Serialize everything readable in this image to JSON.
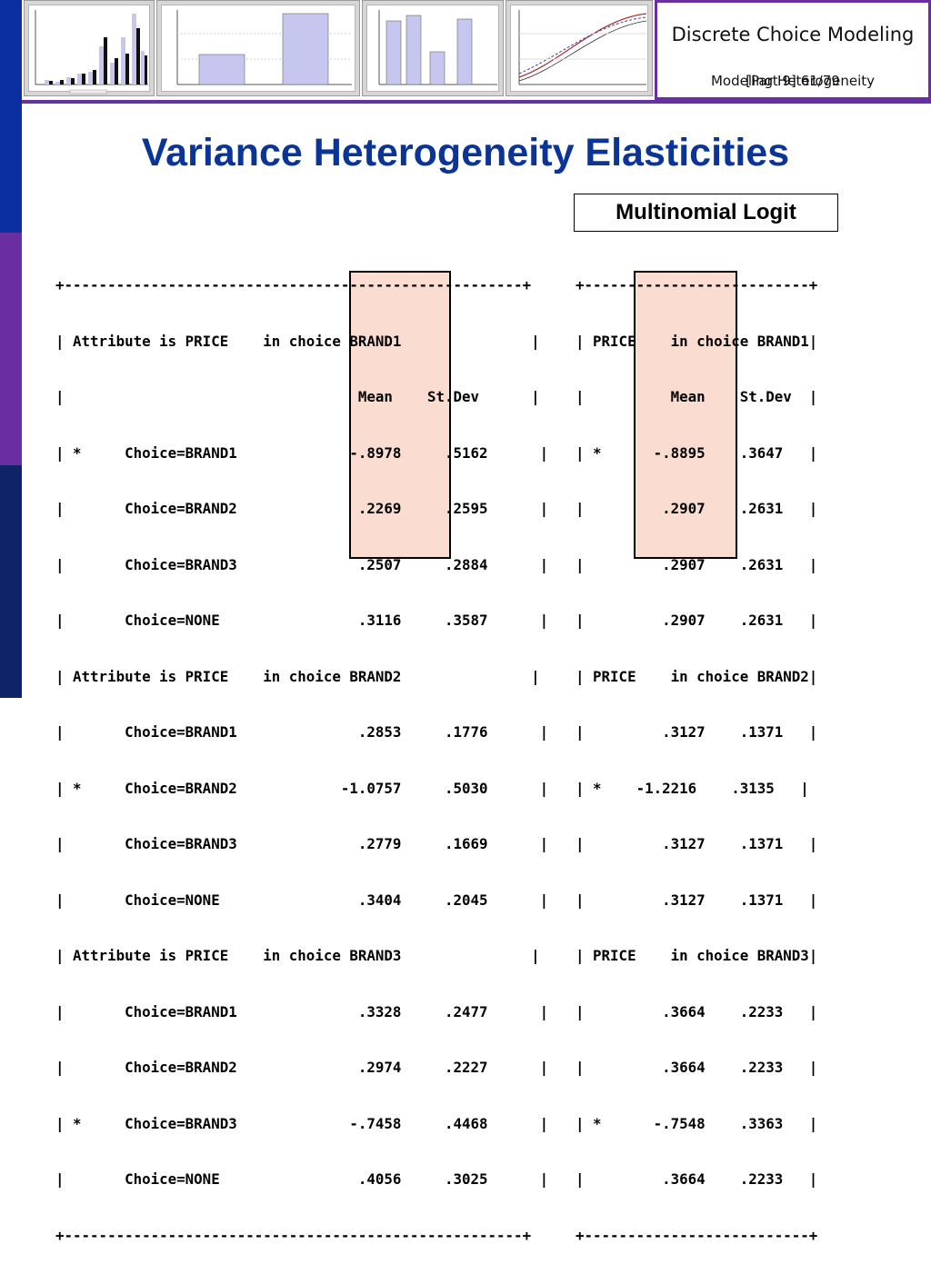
{
  "header": {
    "course_title": "Discrete Choice Modeling",
    "part_label": "[Part 9]",
    "page_label": "61/79",
    "subtitle": "Modeling Heterogeneity",
    "thumbnails": [
      "histogram-thumbnail",
      "bar-chart-thumbnail",
      "column-chart-thumbnail",
      "partial-effects-thumbnail"
    ]
  },
  "slide": {
    "title": "Variance Heterogeneity Elasticities",
    "model_label": "Multinomial Logit"
  },
  "left_table": {
    "border_top": "+-----------------------------------------------------+",
    "border_bottom": "+-----------------------------------------------------+",
    "lines": [
      "| Attribute is PRICE    in choice BRAND1               |",
      "|                                  Mean    St.Dev      |",
      "| *     Choice=BRAND1             -.8978     .5162      |",
      "|       Choice=BRAND2              .2269     .2595      |",
      "|       Choice=BRAND3              .2507     .2884      |",
      "|       Choice=NONE                .3116     .3587      |",
      "| Attribute is PRICE    in choice BRAND2               |",
      "|       Choice=BRAND1              .2853     .1776      |",
      "| *     Choice=BRAND2            -1.0757     .5030      |",
      "|       Choice=BRAND3              .2779     .1669      |",
      "|       Choice=NONE                .3404     .2045      |",
      "| Attribute is PRICE    in choice BRAND3               |",
      "|       Choice=BRAND1              .3328     .2477      |",
      "|       Choice=BRAND2              .2974     .2227      |",
      "| *     Choice=BRAND3             -.7458     .4468      |",
      "|       Choice=NONE                .4056     .3025      |"
    ]
  },
  "right_table": {
    "border_top": "+--------------------------+",
    "border_bottom": "+--------------------------+",
    "lines": [
      "| PRICE    in choice BRAND1|",
      "|          Mean    St.Dev  |",
      "| *      -.8895    .3647   |",
      "|         .2907    .2631   |",
      "|         .2907    .2631   |",
      "|         .2907    .2631   |",
      "| PRICE    in choice BRAND2|",
      "|         .3127    .1371   |",
      "| *    -1.2216    .3135   |",
      "|         .3127    .1371   |",
      "|         .3127    .1371   |",
      "| PRICE    in choice BRAND3|",
      "|         .3664    .2233   |",
      "|         .3664    .2233   |",
      "| *      -.7548    .3363   |",
      "|         .3664    .2233   |"
    ]
  },
  "colors": {
    "title_blue": "#0a3596",
    "accent_purple": "#6a2ea0",
    "highlight_fill": "#fadcd0"
  }
}
